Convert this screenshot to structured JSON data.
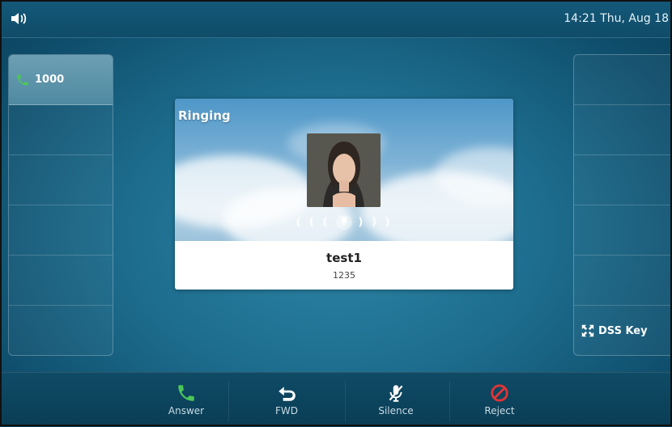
{
  "status_bar": {
    "clock": "14:21 Thu, Aug 18"
  },
  "left_panel": {
    "line_key_label": "1000"
  },
  "right_panel": {
    "dss_key_label": "DSS Key"
  },
  "call": {
    "state": "Ringing",
    "caller_name": "test1",
    "caller_number": "1235",
    "ring_indicator_left": "( ( (",
    "ring_indicator_right": ") ) )"
  },
  "softkeys": {
    "answer": "Answer",
    "fwd": "FWD",
    "silence": "Silence",
    "reject": "Reject"
  },
  "colors": {
    "answer_icon": "#4cc65a",
    "reject_icon": "#e23434",
    "line_icon": "#4cc65a"
  }
}
